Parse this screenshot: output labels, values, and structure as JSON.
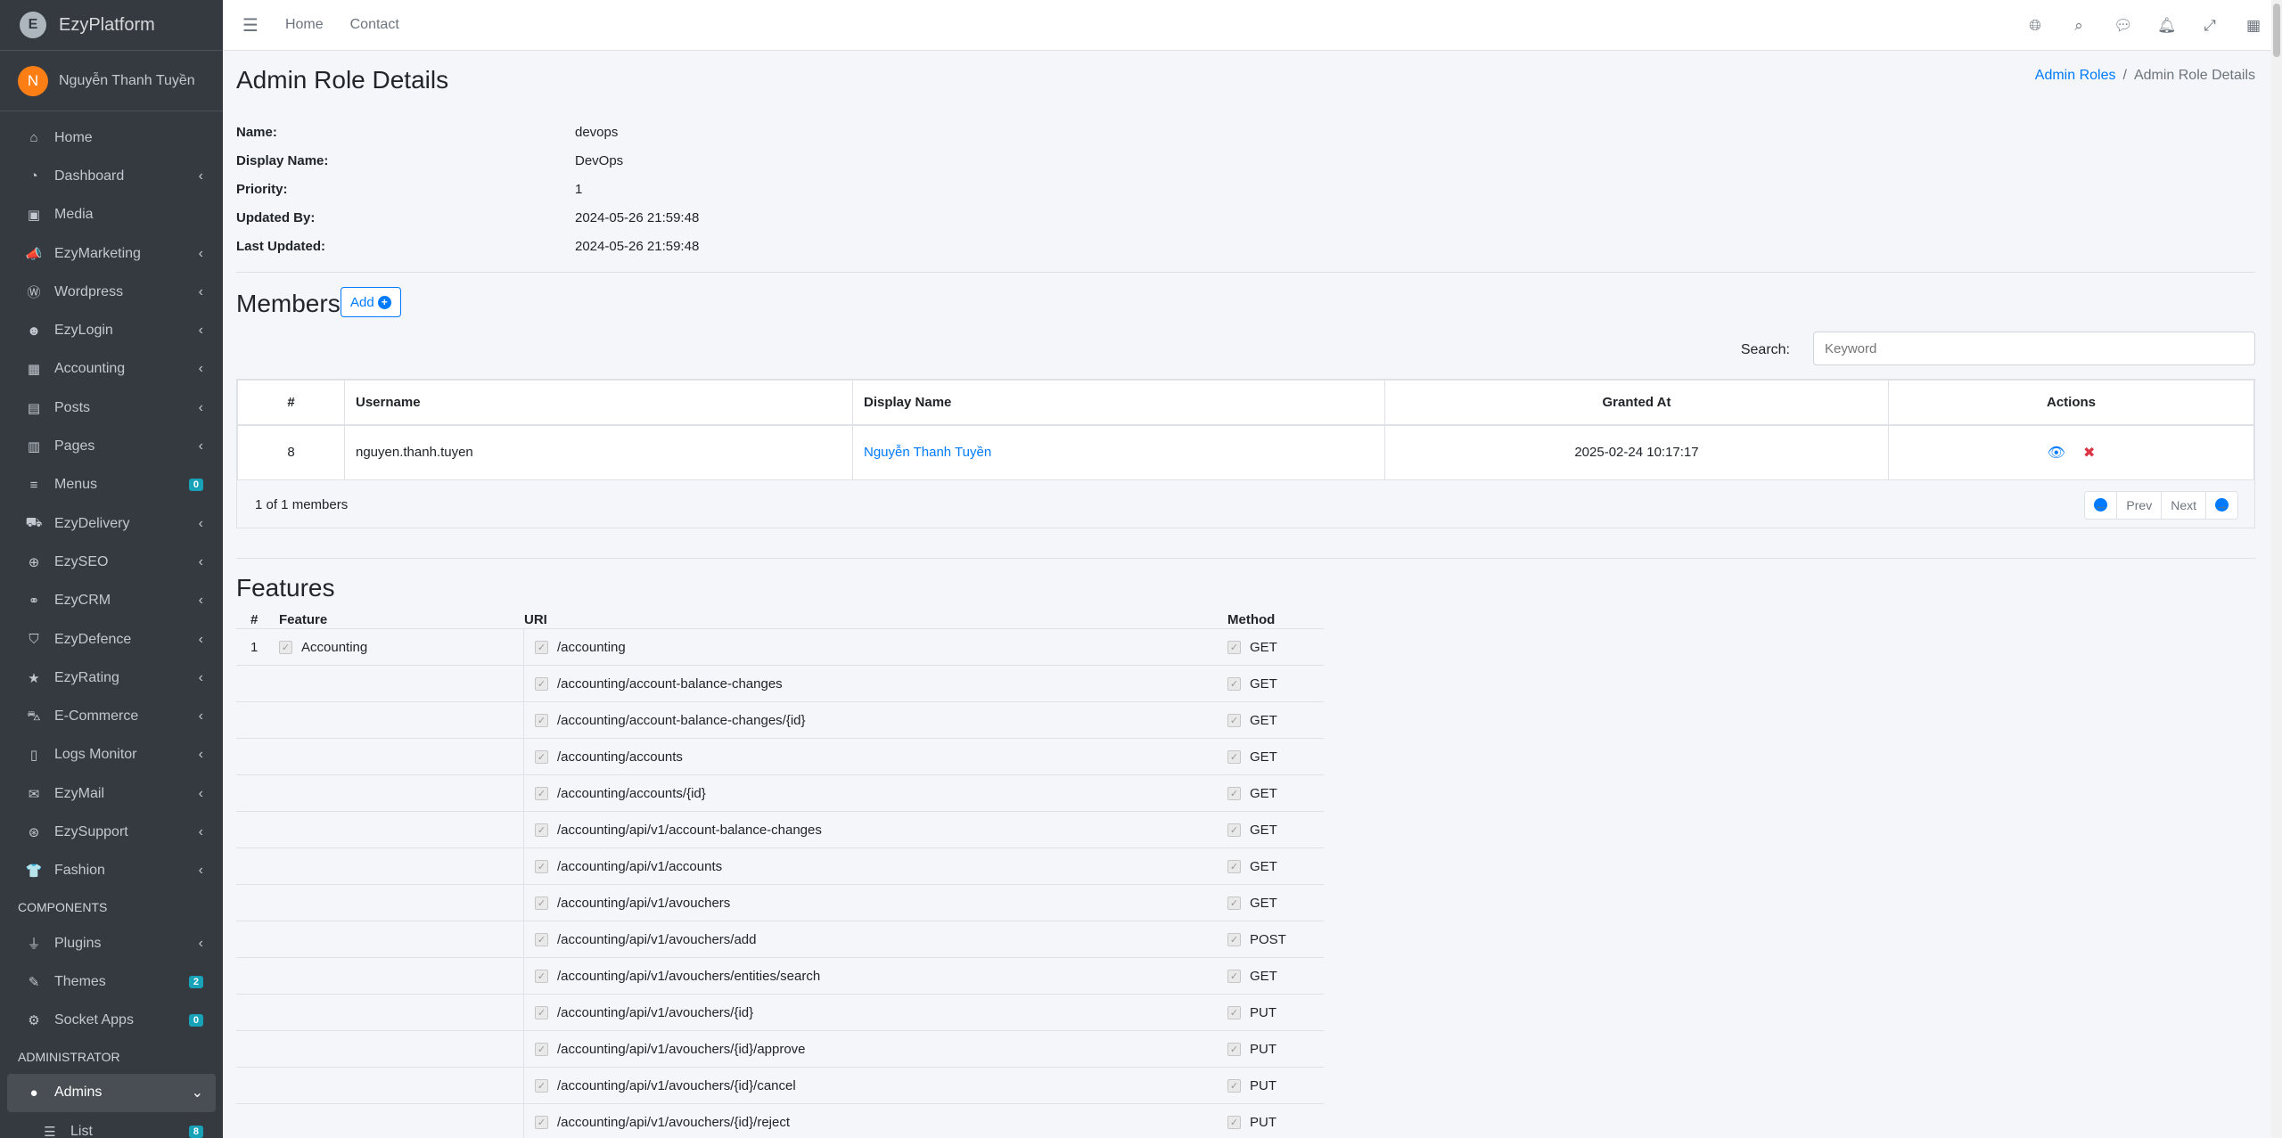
{
  "brand": {
    "name": "EzyPlatform",
    "logo_letter": "E"
  },
  "user": {
    "initial": "N",
    "name": "Nguyễn Thanh Tuyền"
  },
  "sidebar": {
    "items": [
      {
        "label": "Home",
        "icon": "home-icon",
        "glyph": "⌂",
        "chevron": false
      },
      {
        "label": "Dashboard",
        "icon": "dashboard-icon",
        "glyph": "◔",
        "chevron": true
      },
      {
        "label": "Media",
        "icon": "image-icon",
        "glyph": "▣",
        "chevron": false
      },
      {
        "label": "EzyMarketing",
        "icon": "bullhorn-icon",
        "glyph": "📣",
        "chevron": true
      },
      {
        "label": "Wordpress",
        "icon": "wordpress-icon",
        "glyph": "Ⓦ",
        "chevron": true
      },
      {
        "label": "EzyLogin",
        "icon": "user-lock-icon",
        "glyph": "☻",
        "chevron": true
      },
      {
        "label": "Accounting",
        "icon": "calculator-icon",
        "glyph": "▦",
        "chevron": true
      },
      {
        "label": "Posts",
        "icon": "posts-icon",
        "glyph": "▤",
        "chevron": true
      },
      {
        "label": "Pages",
        "icon": "book-icon",
        "glyph": "▥",
        "chevron": true
      },
      {
        "label": "Menus",
        "icon": "bars-icon",
        "glyph": "≡",
        "badge": "0"
      },
      {
        "label": "EzyDelivery",
        "icon": "truck-icon",
        "glyph": "⛟",
        "chevron": true
      },
      {
        "label": "EzySEO",
        "icon": "search-plus-icon",
        "glyph": "⊕",
        "chevron": true
      },
      {
        "label": "EzyCRM",
        "icon": "handshake-icon",
        "glyph": "⚭",
        "chevron": true
      },
      {
        "label": "EzyDefence",
        "icon": "shield-icon",
        "glyph": "⛉",
        "chevron": true
      },
      {
        "label": "EzyRating",
        "icon": "star-icon",
        "glyph": "★",
        "chevron": true
      },
      {
        "label": "E-Commerce",
        "icon": "basket-icon",
        "glyph": "⛍",
        "chevron": true
      },
      {
        "label": "Logs Monitor",
        "icon": "file-icon",
        "glyph": "▯",
        "chevron": true
      },
      {
        "label": "EzyMail",
        "icon": "envelope-icon",
        "glyph": "✉",
        "chevron": true
      },
      {
        "label": "EzySupport",
        "icon": "lifebuoy-icon",
        "glyph": "⊛",
        "chevron": true
      },
      {
        "label": "Fashion",
        "icon": "tshirt-icon",
        "glyph": "👕",
        "chevron": true
      }
    ],
    "components_header": "COMPONENTS",
    "component_items": [
      {
        "label": "Plugins",
        "icon": "plug-icon",
        "glyph": "⏚",
        "chevron": true
      },
      {
        "label": "Themes",
        "icon": "brush-icon",
        "glyph": "✎",
        "badge": "2"
      },
      {
        "label": "Socket Apps",
        "icon": "cogs-icon",
        "glyph": "⚙",
        "badge": "0"
      }
    ],
    "admin_header": "ADMINISTRATOR",
    "admins": {
      "label": "Admins",
      "icon": "user-circle-icon",
      "glyph": "●"
    },
    "list": {
      "label": "List",
      "icon": "list-icon",
      "glyph": "☰",
      "badge": "8"
    }
  },
  "topbar": {
    "home": "Home",
    "contact": "Contact"
  },
  "page": {
    "title": "Admin Role Details",
    "breadcrumb": {
      "parent": "Admin Roles",
      "current": "Admin Role Details"
    }
  },
  "details": [
    {
      "label": "Name:",
      "value": "devops"
    },
    {
      "label": "Display Name:",
      "value": "DevOps"
    },
    {
      "label": "Priority:",
      "value": "1"
    },
    {
      "label": "Updated By:",
      "value": "2024-05-26 21:59:48"
    },
    {
      "label": "Last Updated:",
      "value": "2024-05-26 21:59:48"
    }
  ],
  "members": {
    "title": "Members",
    "add_label": "Add",
    "search_label": "Search:",
    "search_placeholder": "Keyword",
    "headers": {
      "num": "#",
      "username": "Username",
      "display_name": "Display Name",
      "granted_at": "Granted At",
      "actions": "Actions"
    },
    "rows": [
      {
        "num": "8",
        "username": "nguyen.thanh.tuyen",
        "display_name": "Nguyễn Thanh Tuyền",
        "granted_at": "2025-02-24 10:17:17"
      }
    ],
    "count_text": "1 of 1 members",
    "prev": "Prev",
    "next": "Next"
  },
  "features": {
    "title": "Features",
    "headers": {
      "num": "#",
      "feature": "Feature",
      "uri": "URI",
      "method": "Method"
    },
    "feature_num": "1",
    "feature_name": "Accounting",
    "rows": [
      {
        "uri": "/accounting",
        "method": "GET"
      },
      {
        "uri": "/accounting/account-balance-changes",
        "method": "GET"
      },
      {
        "uri": "/accounting/account-balance-changes/{id}",
        "method": "GET"
      },
      {
        "uri": "/accounting/accounts",
        "method": "GET"
      },
      {
        "uri": "/accounting/accounts/{id}",
        "method": "GET"
      },
      {
        "uri": "/accounting/api/v1/account-balance-changes",
        "method": "GET"
      },
      {
        "uri": "/accounting/api/v1/accounts",
        "method": "GET"
      },
      {
        "uri": "/accounting/api/v1/avouchers",
        "method": "GET"
      },
      {
        "uri": "/accounting/api/v1/avouchers/add",
        "method": "POST"
      },
      {
        "uri": "/accounting/api/v1/avouchers/entities/search",
        "method": "GET"
      },
      {
        "uri": "/accounting/api/v1/avouchers/{id}",
        "method": "PUT"
      },
      {
        "uri": "/accounting/api/v1/avouchers/{id}/approve",
        "method": "PUT"
      },
      {
        "uri": "/accounting/api/v1/avouchers/{id}/cancel",
        "method": "PUT"
      },
      {
        "uri": "/accounting/api/v1/avouchers/{id}/reject",
        "method": "PUT"
      }
    ]
  }
}
